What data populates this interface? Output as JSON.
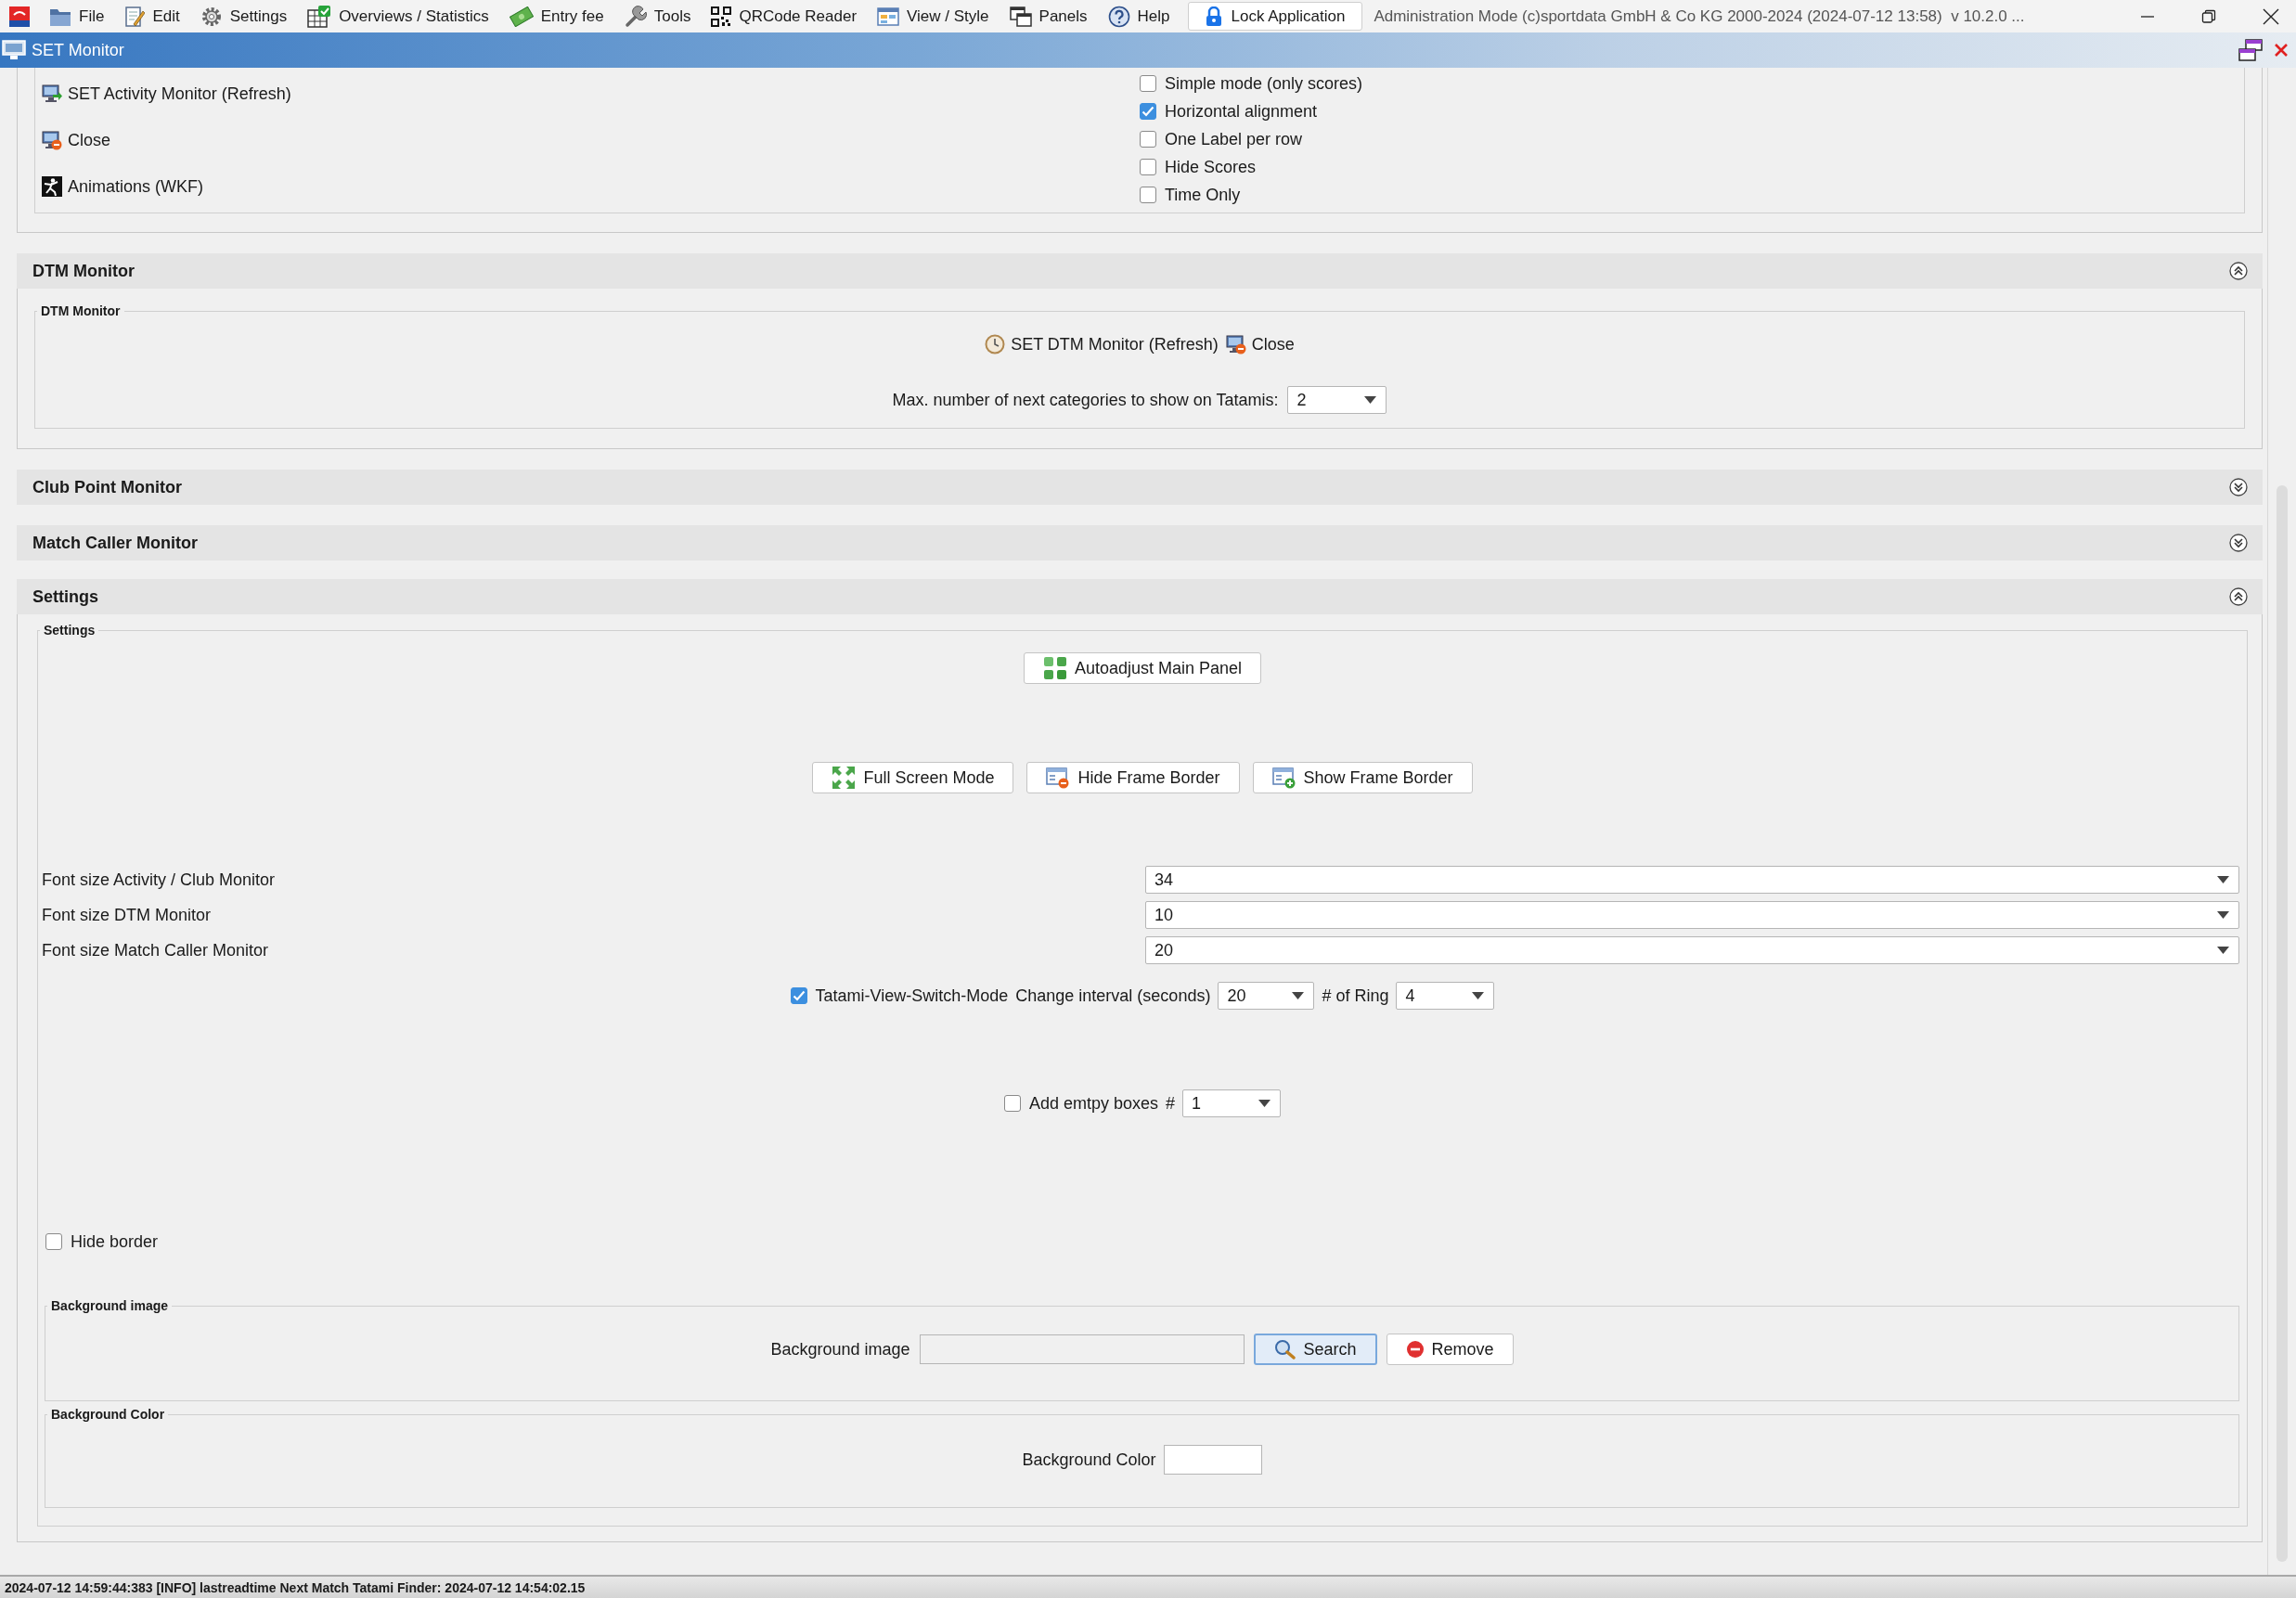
{
  "menu_bar": {
    "items": [
      {
        "label": "File"
      },
      {
        "label": "Edit"
      },
      {
        "label": "Settings"
      },
      {
        "label": "Overviews / Statistics"
      },
      {
        "label": "Entry fee"
      },
      {
        "label": "Tools"
      },
      {
        "label": "QRCode Reader"
      },
      {
        "label": "View / Style"
      },
      {
        "label": "Panels"
      },
      {
        "label": "Help"
      }
    ],
    "lock_button": "Lock Application",
    "app_info": "Administration Mode (c)sportdata GmbH & Co KG 2000-2024 (2024-07-12 13:58)  v 10.2.0 ..."
  },
  "window": {
    "title": "SET Monitor"
  },
  "activity_section": {
    "links": [
      "SET Activity Monitor (Refresh)",
      "Close",
      "Animations (WKF)"
    ],
    "options": [
      {
        "label": "Simple mode (only scores)",
        "checked": false
      },
      {
        "label": "Horizontal alignment",
        "checked": true
      },
      {
        "label": "One Label per row",
        "checked": false
      },
      {
        "label": "Hide Scores",
        "checked": false
      },
      {
        "label": "Time Only",
        "checked": false
      }
    ]
  },
  "dtm_section": {
    "title": "DTM Monitor",
    "expanded": true,
    "group_title": "DTM Monitor",
    "refresh_link": "SET DTM Monitor (Refresh)",
    "close_link": "Close",
    "categories_label": "Max. number of next categories to show on Tatamis:",
    "categories_value": "2"
  },
  "club_point_section": {
    "title": "Club Point Monitor",
    "expanded": false
  },
  "match_caller_section": {
    "title": "Match Caller Monitor",
    "expanded": false
  },
  "settings_section": {
    "title": "Settings",
    "expanded": true,
    "group_title": "Settings",
    "autoadjust_button": {
      "label": "Autoadjust Main Panel"
    },
    "frame_buttons": [
      {
        "label": "Full Screen Mode"
      },
      {
        "label": "Hide Frame Border"
      },
      {
        "label": "Show Frame Border"
      }
    ],
    "font_sizes": [
      {
        "label": "Font size Activity / Club Monitor",
        "value": "34"
      },
      {
        "label": "Font size DTM Monitor",
        "value": "10"
      },
      {
        "label": "Font size Match Caller Monitor",
        "value": "20"
      }
    ],
    "tatami_switch": {
      "label": "Tatami-View-Switch-Mode",
      "checked": true,
      "interval_label": "Change interval (seconds)",
      "interval": "20",
      "ring_label": "# of Ring",
      "ring": "4"
    },
    "empty_boxes": {
      "label": "Add emtpy boxes",
      "checked": false,
      "count_label": "#",
      "count": "1"
    },
    "hide_border": {
      "label": "Hide border",
      "checked": false
    },
    "background_image": {
      "group_title": "Background image",
      "label": "Background image",
      "search_button": {
        "label": "Search",
        "focused": true
      },
      "remove_button": {
        "label": "Remove",
        "focused": false
      }
    },
    "background_color": {
      "group_title": "Background Color",
      "label": "Background Color"
    }
  },
  "status_bar": {
    "text": "2024-07-12 14:59:44:383 [INFO] lastreadtime Next Match Tatami Finder: 2024-07-12 14:54:02.15"
  }
}
